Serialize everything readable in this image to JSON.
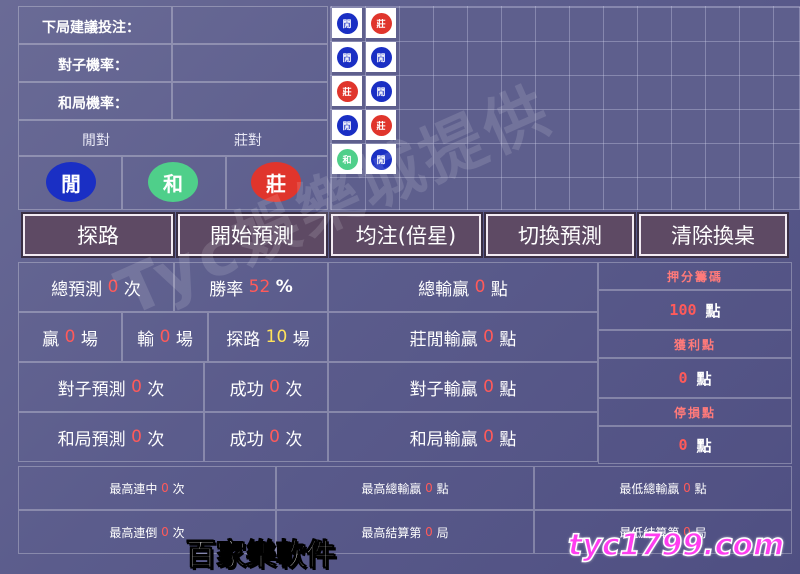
{
  "prediction_panel": {
    "next_bet_label": "下局建議投注：",
    "pair_rate_label": "對子機率：",
    "tie_rate_label": "和局機率：",
    "player_pair_label": "閒對",
    "banker_pair_label": "莊對",
    "player_button": "閒",
    "tie_button": "和",
    "banker_button": "莊"
  },
  "road_beads": [
    {
      "text": "閒",
      "color": "#1a2fc4"
    },
    {
      "text": "莊",
      "color": "#e0352c"
    },
    {
      "text": "閒",
      "color": "#1a2fc4"
    },
    {
      "text": "閒",
      "color": "#1a2fc4"
    },
    {
      "text": "莊",
      "color": "#e0352c"
    },
    {
      "text": "閒",
      "color": "#1a2fc4"
    },
    {
      "text": "閒",
      "color": "#1a2fc4"
    },
    {
      "text": "莊",
      "color": "#e0352c"
    },
    {
      "text": "和",
      "color": "#4fcf8a"
    },
    {
      "text": "閒",
      "color": "#1a2fc4"
    }
  ],
  "toolbar": {
    "explore": "探路",
    "start_predict": "開始預測",
    "flat_bet": "均注(倍星)",
    "switch_predict": "切換預測",
    "clear_table": "清除換桌"
  },
  "stats": {
    "total_predict_label": "總預測",
    "total_predict": "0",
    "times": "次",
    "win_rate_label": "勝率",
    "win_rate": "52",
    "percent": "%",
    "total_winloss_label": "總輸贏",
    "total_winloss": "0",
    "points": "點",
    "win_label": "贏",
    "win": "0",
    "games": "場",
    "lose_label": "輸",
    "lose": "0",
    "explore_label": "探路",
    "explore": "10",
    "bp_winloss_label": "莊閒輸贏",
    "bp_winloss": "0",
    "pair_predict_label": "對子預測",
    "pair_predict": "0",
    "pair_success_label": "成功",
    "pair_success": "0",
    "pair_winloss_label": "對子輸贏",
    "pair_winloss": "0",
    "tie_predict_label": "和局預測",
    "tie_predict": "0",
    "tie_success_label": "成功",
    "tie_success": "0",
    "tie_winloss_label": "和局輸贏",
    "tie_winloss": "0"
  },
  "side_panel": {
    "bet_chip_label": "押分籌碼",
    "bet_chip": "100",
    "points": "點",
    "take_profit_label": "獲利點",
    "take_profit": "0",
    "stop_loss_label": "停損點",
    "stop_loss": "0"
  },
  "records": {
    "max_win_streak_label": "最高連中",
    "max_win_streak": "0",
    "times": "次",
    "max_total_win_label": "最高總輸贏",
    "max_total_win": "0",
    "points": "點",
    "min_total_win_label": "最低總輸贏",
    "min_total_win": "0",
    "max_lose_streak_label": "最高連倒",
    "max_lose_streak": "0",
    "max_settle_label": "最高結算第",
    "max_settle": "0",
    "rounds": "局",
    "min_settle_label": "最低結算第",
    "min_settle": "0"
  },
  "overlay": {
    "watermark": "Tyc娛樂城提供",
    "caption": "百家樂軟件",
    "site": "tyc1799.com"
  },
  "colors": {
    "player": "#1a2fc4",
    "tie": "#4fcf8a",
    "banker": "#e0352c",
    "value_red": "#ff5a5a",
    "value_yellow": "#ffe25a"
  }
}
